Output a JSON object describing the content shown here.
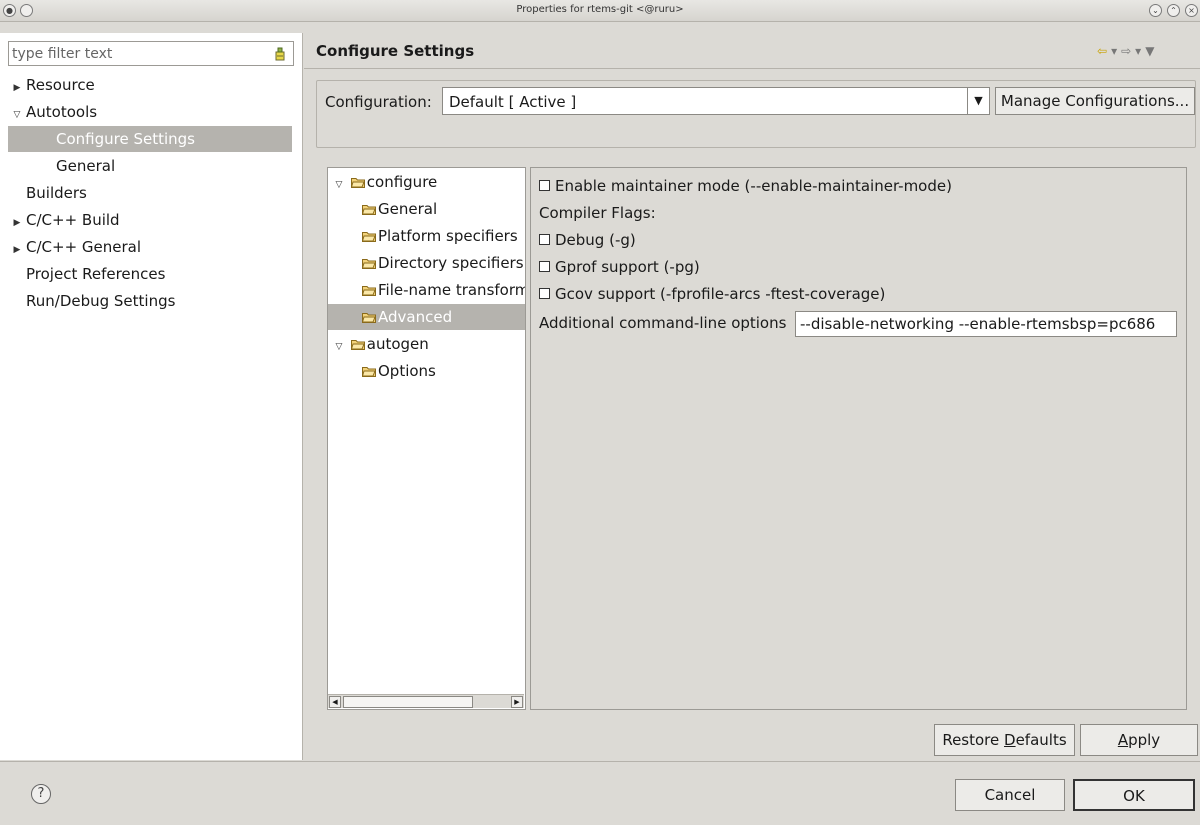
{
  "window": {
    "title": "Properties for rtems-git <@ruru>"
  },
  "filter": {
    "placeholder": "type filter text"
  },
  "nav": {
    "items": [
      {
        "label": "Resource",
        "twisty": "▶"
      },
      {
        "label": "Autotools",
        "twisty": "▽"
      },
      {
        "label": "Configure Settings",
        "twisty": ""
      },
      {
        "label": "General",
        "twisty": ""
      },
      {
        "label": "Builders",
        "twisty": ""
      },
      {
        "label": "C/C++ Build",
        "twisty": "▶"
      },
      {
        "label": "C/C++ General",
        "twisty": "▶"
      },
      {
        "label": "Project References",
        "twisty": ""
      },
      {
        "label": "Run/Debug Settings",
        "twisty": ""
      }
    ]
  },
  "page": {
    "heading": "Configure Settings"
  },
  "configuration": {
    "label": "Configuration:",
    "value": "Default  [ Active ]",
    "manage_label": "Manage Configurations..."
  },
  "tree": {
    "items": [
      {
        "label": "configure",
        "twisty": "▽"
      },
      {
        "label": "General",
        "twisty": ""
      },
      {
        "label": "Platform specifiers",
        "twisty": ""
      },
      {
        "label": "Directory specifiers",
        "twisty": ""
      },
      {
        "label": "File-name transformations",
        "twisty": ""
      },
      {
        "label": "Advanced",
        "twisty": ""
      },
      {
        "label": "autogen",
        "twisty": "▽"
      },
      {
        "label": "Options",
        "twisty": ""
      }
    ]
  },
  "settings": {
    "maintainer_mode": "Enable maintainer mode (--enable-maintainer-mode)",
    "compiler_flags": "Compiler Flags:",
    "debug": "Debug (-g)",
    "gprof": "Gprof support (-pg)",
    "gcov": "Gcov support (-fprofile-arcs -ftest-coverage)",
    "additional_label": "Additional command-line options",
    "additional_value": "--disable-networking --enable-rtemsbsp=pc686"
  },
  "buttons": {
    "restore_prefix": "Restore ",
    "restore_accel": "D",
    "restore_suffix": "efaults",
    "apply_accel": "A",
    "apply_suffix": "pply",
    "cancel": "Cancel",
    "ok": "OK"
  },
  "icons": {
    "help": "?"
  },
  "colors": {
    "selection": "#b5b3ae",
    "window_bg": "#dcdad5",
    "history_arrow": "#c9a200"
  }
}
